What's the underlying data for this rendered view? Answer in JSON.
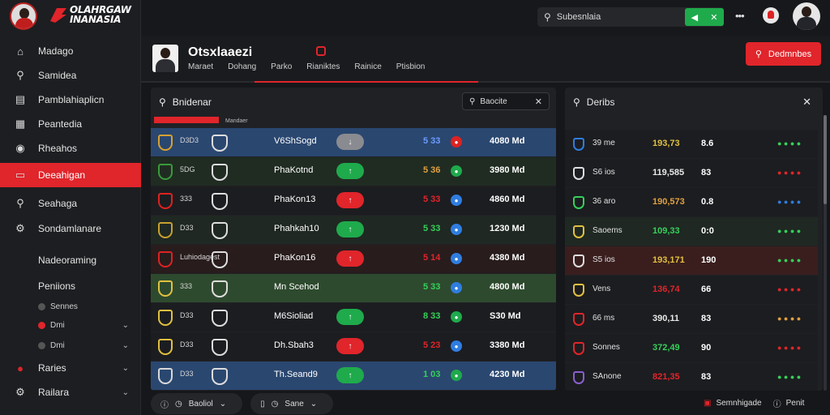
{
  "brand": {
    "line1": "OLAHRGAW",
    "line2": "INANASIA"
  },
  "colors": {
    "accent": "#e0252b",
    "green": "#1faa4c",
    "panel": "#202125",
    "bg": "#16171a"
  },
  "topbar": {
    "search_placeholder": "Subesnlaia",
    "green_btn": [
      "◀",
      "✕"
    ]
  },
  "nav": [
    {
      "label": "Madago",
      "icon": "home-icon"
    },
    {
      "label": "Samidea",
      "icon": "search-icon"
    },
    {
      "label": "Pamblahiaplicn",
      "icon": "table-icon"
    },
    {
      "label": "Peantedia",
      "icon": "calendar-icon"
    },
    {
      "label": "Rheahos",
      "icon": "play-icon"
    },
    {
      "label": "Deeahigan",
      "icon": "card-icon"
    },
    {
      "label": "Seahaga",
      "icon": "search-icon"
    },
    {
      "label": "Sondamlanare",
      "icon": "gear-icon"
    }
  ],
  "nav_sections": {
    "section1": "Nadeoraming",
    "section2": "Peniions"
  },
  "nav_subs": [
    "Sennes",
    "Dmi",
    "Dmi"
  ],
  "nav_bottom": [
    {
      "label": "Raries"
    },
    {
      "label": "Railara"
    }
  ],
  "header": {
    "title": "Otsxlaaezi",
    "tabs": [
      "Maraet",
      "Dohang",
      "Parko",
      "Rianiktes",
      "Rainice",
      "Ptisbion"
    ],
    "red_button": "Dedmnbes"
  },
  "left_panel": {
    "title": "Bnidenar",
    "search": "Baocite",
    "subtitle": "Mandaer",
    "rows": [
      {
        "code": "D3D3",
        "name": "V6ShSogd",
        "pill": "↓",
        "pill_color": "#8a8b90",
        "odds": "5 33",
        "odds_color": "#6d9bff",
        "st_color": "#d22",
        "amount": "4080 Md",
        "bg": "#2a4770"
      },
      {
        "code": "5DG",
        "name": "PhaKotnd",
        "pill": "↑",
        "pill_color": "#1faa4c",
        "odds": "5 36",
        "odds_color": "#e0a040",
        "st_color": "#1faa4c",
        "amount": "3980 Md",
        "bg": "#202c22"
      },
      {
        "code": "333",
        "name": "PhaKon13",
        "pill": "↑",
        "pill_color": "#e0252b",
        "odds": "5 33",
        "odds_color": "#e0252b",
        "st_color": "#2f7de0",
        "amount": "4860 Md",
        "bg": "#1c1d20"
      },
      {
        "code": "D33",
        "name": "Phahkah10",
        "pill": "↑",
        "pill_color": "#1faa4c",
        "odds": "5 33",
        "odds_color": "#35d05a",
        "st_color": "#2f7de0",
        "amount": "1230 Md",
        "bg": "#1f2822"
      },
      {
        "code": "Luhiodagest",
        "name": "PhaKon16",
        "pill": "↑",
        "pill_color": "#e0252b",
        "odds": "5 14",
        "odds_color": "#e0252b",
        "st_color": "#2f7de0",
        "amount": "4380 Md",
        "bg": "#281c1d"
      },
      {
        "code": "333",
        "name": "Mn Scehod",
        "pill": "",
        "pill_color": "transparent",
        "odds": "5 33",
        "odds_color": "#35d05a",
        "st_color": "#2f7de0",
        "amount": "4800 Md",
        "bg": "#2e4a2e"
      },
      {
        "code": "D33",
        "name": "M6Sioliad",
        "pill": "↑",
        "pill_color": "#1faa4c",
        "odds": "8 33",
        "odds_color": "#35d05a",
        "st_color": "#1faa4c",
        "amount": "S30 Md",
        "bg": "#1c1d20"
      },
      {
        "code": "D33",
        "name": "Dh.Sbah3",
        "pill": "↑",
        "pill_color": "#e0252b",
        "odds": "5 23",
        "odds_color": "#e0252b",
        "st_color": "#2f7de0",
        "amount": "3380 Md",
        "bg": "#1c1d20"
      },
      {
        "code": "D33",
        "name": "Th.Seand9",
        "pill": "↑",
        "pill_color": "#1faa4c",
        "odds": "1 03",
        "odds_color": "#35d05a",
        "st_color": "#1faa4c",
        "amount": "4230 Md",
        "bg": "#2a4770"
      }
    ],
    "footer": [
      {
        "label": "Baoliol"
      },
      {
        "label": "Sane"
      }
    ]
  },
  "right_panel": {
    "title": "Deribs",
    "rows": [
      {
        "label": "39 me",
        "val": "193,73",
        "val_color": "#e0c040",
        "num": "8.6",
        "trend": "● ● ● ●",
        "trend_color": "#35d05a",
        "bg": "#1c1d20"
      },
      {
        "label": "S6 ios",
        "val": "119,585",
        "val_color": "#e8e8e8",
        "num": "83",
        "trend": "● ● ● ●",
        "trend_color": "#e0252b",
        "bg": "#1c1d20"
      },
      {
        "label": "36 aro",
        "val": "190,573",
        "val_color": "#e0a040",
        "num": "0.8",
        "trend": "● ● ● ●",
        "trend_color": "#2f7de0",
        "bg": "#1c1d20"
      },
      {
        "label": "Saoems",
        "val": "109,33",
        "val_color": "#35d05a",
        "num": "0:0",
        "trend": "● ● ● ●",
        "trend_color": "#35d05a",
        "bg": "#1f2822"
      },
      {
        "label": "S5 ios",
        "val": "193,171",
        "val_color": "#e0c040",
        "num": "190",
        "trend": "● ● ● ●",
        "trend_color": "#35d05a",
        "bg": "#3a1e1e"
      },
      {
        "label": "Vens",
        "val": "136,74",
        "val_color": "#e0252b",
        "num": "66",
        "trend": "● ● ● ●",
        "trend_color": "#e0252b",
        "bg": "#1c1d20"
      },
      {
        "label": "66 ms",
        "val": "390,11",
        "val_color": "#e8e8e8",
        "num": "83",
        "trend": "● ● ● ●",
        "trend_color": "#e0a040",
        "bg": "#1c1d20"
      },
      {
        "label": "Sonnes",
        "val": "372,49",
        "val_color": "#35d05a",
        "num": "90",
        "trend": "● ● ● ●",
        "trend_color": "#e0252b",
        "bg": "#1c1d20"
      },
      {
        "label": "SAnone",
        "val": "821,35",
        "val_color": "#e0252b",
        "num": "83",
        "trend": "● ● ● ●",
        "trend_color": "#35d05a",
        "bg": "#1c1d20"
      }
    ],
    "footer_links": [
      {
        "label": "Semnhigade"
      },
      {
        "label": "Penit"
      }
    ]
  }
}
